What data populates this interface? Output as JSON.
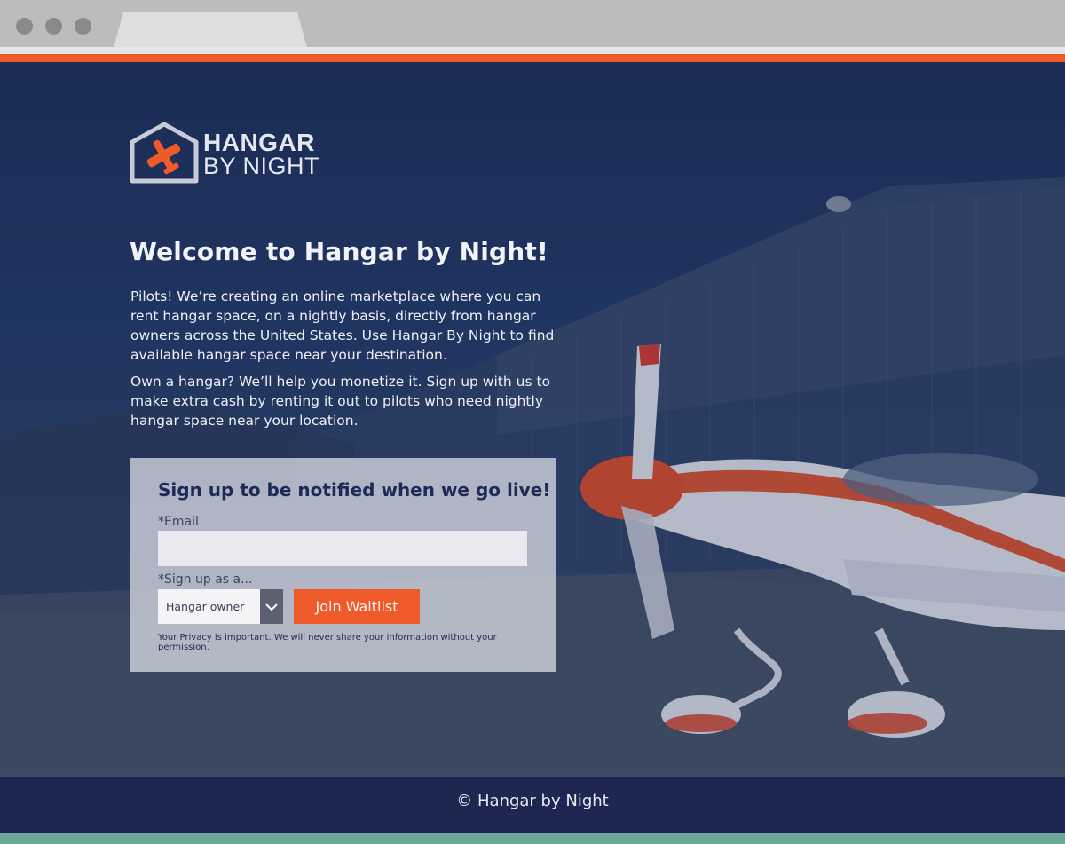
{
  "logo": {
    "line1": "HANGAR",
    "line2": "BY NIGHT"
  },
  "welcome": {
    "title": "Welcome to Hangar by Night!"
  },
  "intro": {
    "paragraph1": "Pilots! We’re creating an online marketplace where you can rent hangar space, on a nightly basis, directly from hangar owners across the United States. Use Hangar By Night to find available hangar space near your destination.",
    "paragraph2": "Own a hangar? We’ll help you monetize it. Sign up with us to make extra cash by renting it out to pilots who need nightly hangar space near your location."
  },
  "signup": {
    "title": "Sign up to be notified when we go live!",
    "email_label": "*Email",
    "email_value": "",
    "role_label": "*Sign up as a...",
    "role_selected": "Hangar owner",
    "join_label": "Join Waitlist",
    "privacy": "Your Privacy is important. We will never share your information without your permission."
  },
  "footer": {
    "text": "© Hangar by Night"
  },
  "colors": {
    "accent": "#ee5a2a",
    "navy": "#1d2752",
    "strip": "#6aa898"
  }
}
